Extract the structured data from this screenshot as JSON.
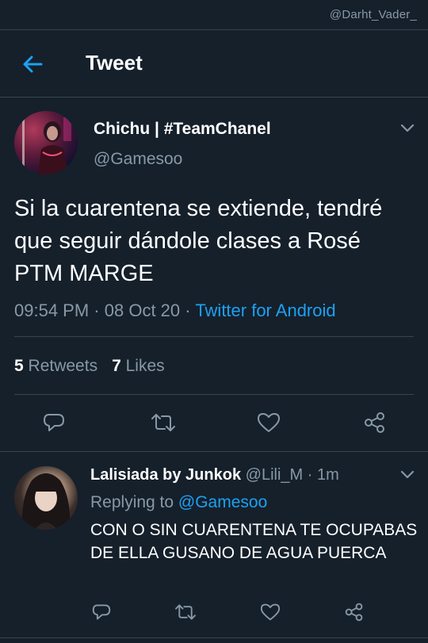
{
  "watermark": "@Darht_Vader_",
  "header": {
    "title": "Tweet",
    "back_icon": "arrow-left-icon",
    "accent": "#1da1f2"
  },
  "tweet": {
    "author_name": "Chichu | #TeamChanel",
    "author_handle": "@Gamesoo",
    "text": "Si la cuarentena se extiende, tendré que seguir dándole clases a Rosé PTM MARGE",
    "time": "09:54 PM",
    "date": "08 Oct 20",
    "separator": "·",
    "source": "Twitter for Android",
    "retweets_count": "5",
    "retweets_label": "Retweets",
    "likes_count": "7",
    "likes_label": "Likes"
  },
  "reply": {
    "author_name": "Lalisiada by Junkok",
    "author_handle": "@Lili_M",
    "separator": "·",
    "age": "1m",
    "replying_to_label": "Replying to",
    "replying_to_handle": "@Gamesoo",
    "text": "CON O SIN CUARENTENA TE OCUPABAS DE ELLA GUSANO DE AGUA PUERCA"
  },
  "colors": {
    "background": "#15202b",
    "muted": "#8899a6",
    "border": "#38444d",
    "link": "#1da1f2"
  }
}
